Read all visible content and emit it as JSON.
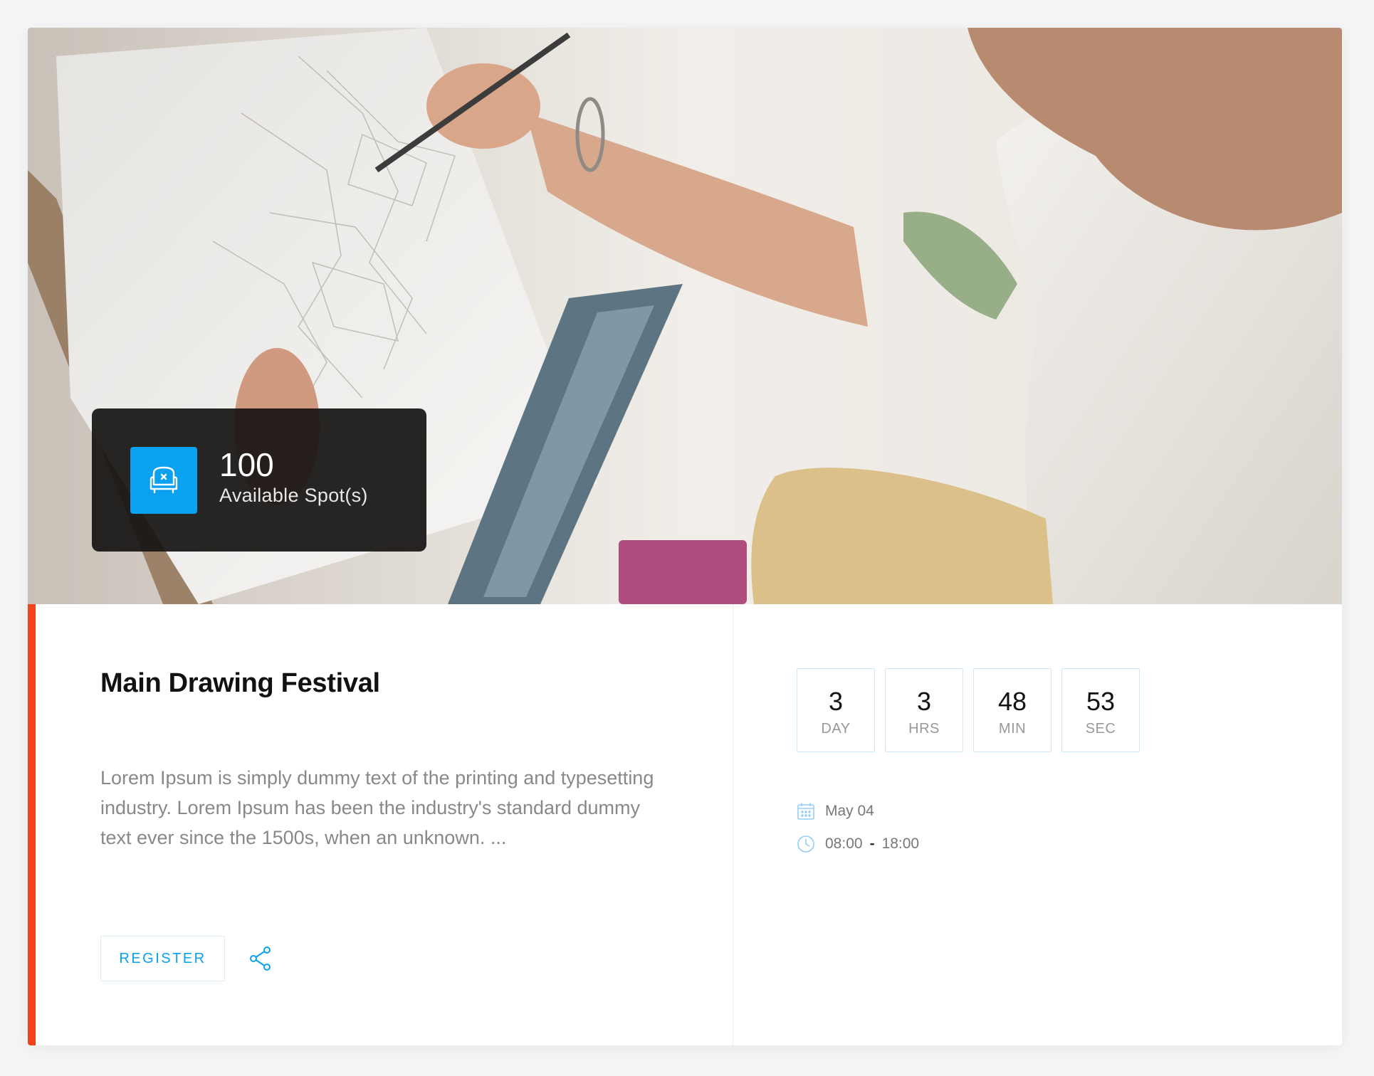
{
  "event": {
    "title": "Main Drawing Festival",
    "description": "Lorem Ipsum is simply dummy text of the printing and typesetting industry. Lorem Ipsum has been the industry's standard dummy text ever since the 1500s, when an unknown. ...",
    "spots": {
      "count": "100",
      "label": "Available Spot(s)",
      "icon": "armchair-icon"
    },
    "register_label": "REGISTER",
    "share_icon": "share-icon",
    "countdown": [
      {
        "value": "3",
        "unit": "DAY"
      },
      {
        "value": "3",
        "unit": "HRS"
      },
      {
        "value": "48",
        "unit": "MIN"
      },
      {
        "value": "53",
        "unit": "SEC"
      }
    ],
    "date": "May 04",
    "time_start": "08:00",
    "time_end": "18:00",
    "date_icon": "calendar-icon",
    "time_icon": "clock-icon"
  },
  "colors": {
    "accent": "#0aa1f0",
    "side_bar": "#f0451c",
    "spots_bg": "#161412"
  }
}
